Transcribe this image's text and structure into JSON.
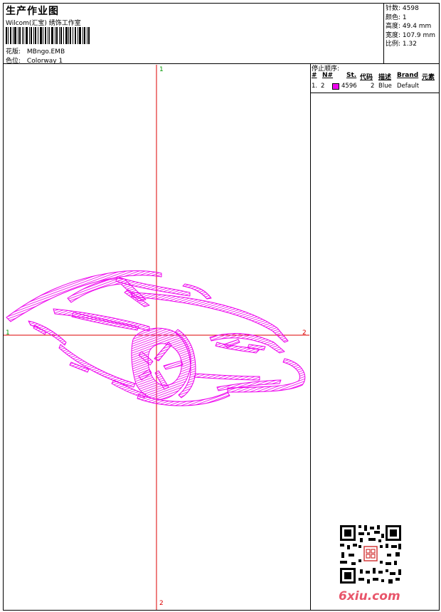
{
  "header": {
    "title": "生产作业图",
    "studio": "Wilcom(汇宝) 绣饰工作室",
    "design_label": "花版:",
    "design_value": "MBngo.EMB",
    "colorway_label": "色位:",
    "colorway_value": "Colorway 1"
  },
  "stats": {
    "stitches": "针数: 4598",
    "colors": "颜色: 1",
    "height": "高度: 49.4 mm",
    "width": "宽度: 107.9 mm",
    "scale": "比例: 1.32"
  },
  "stop_sequence": {
    "title": "停止顺序:",
    "columns": [
      "#",
      "N#",
      "St.",
      "代码",
      "描述",
      "Brand",
      "元素"
    ],
    "rows": [
      {
        "index": "1.",
        "needle": "2",
        "stitches": "4596",
        "code": "2",
        "description": "Blue",
        "brand": "Default",
        "element": ""
      }
    ]
  },
  "axes": {
    "top": "1",
    "bottom": "2",
    "left": "1",
    "right": "2"
  },
  "colors": {
    "thread": "#ee00ee",
    "axis": "#dd0000",
    "axis_label_left": "#009900"
  },
  "watermark": "6xiu.com"
}
